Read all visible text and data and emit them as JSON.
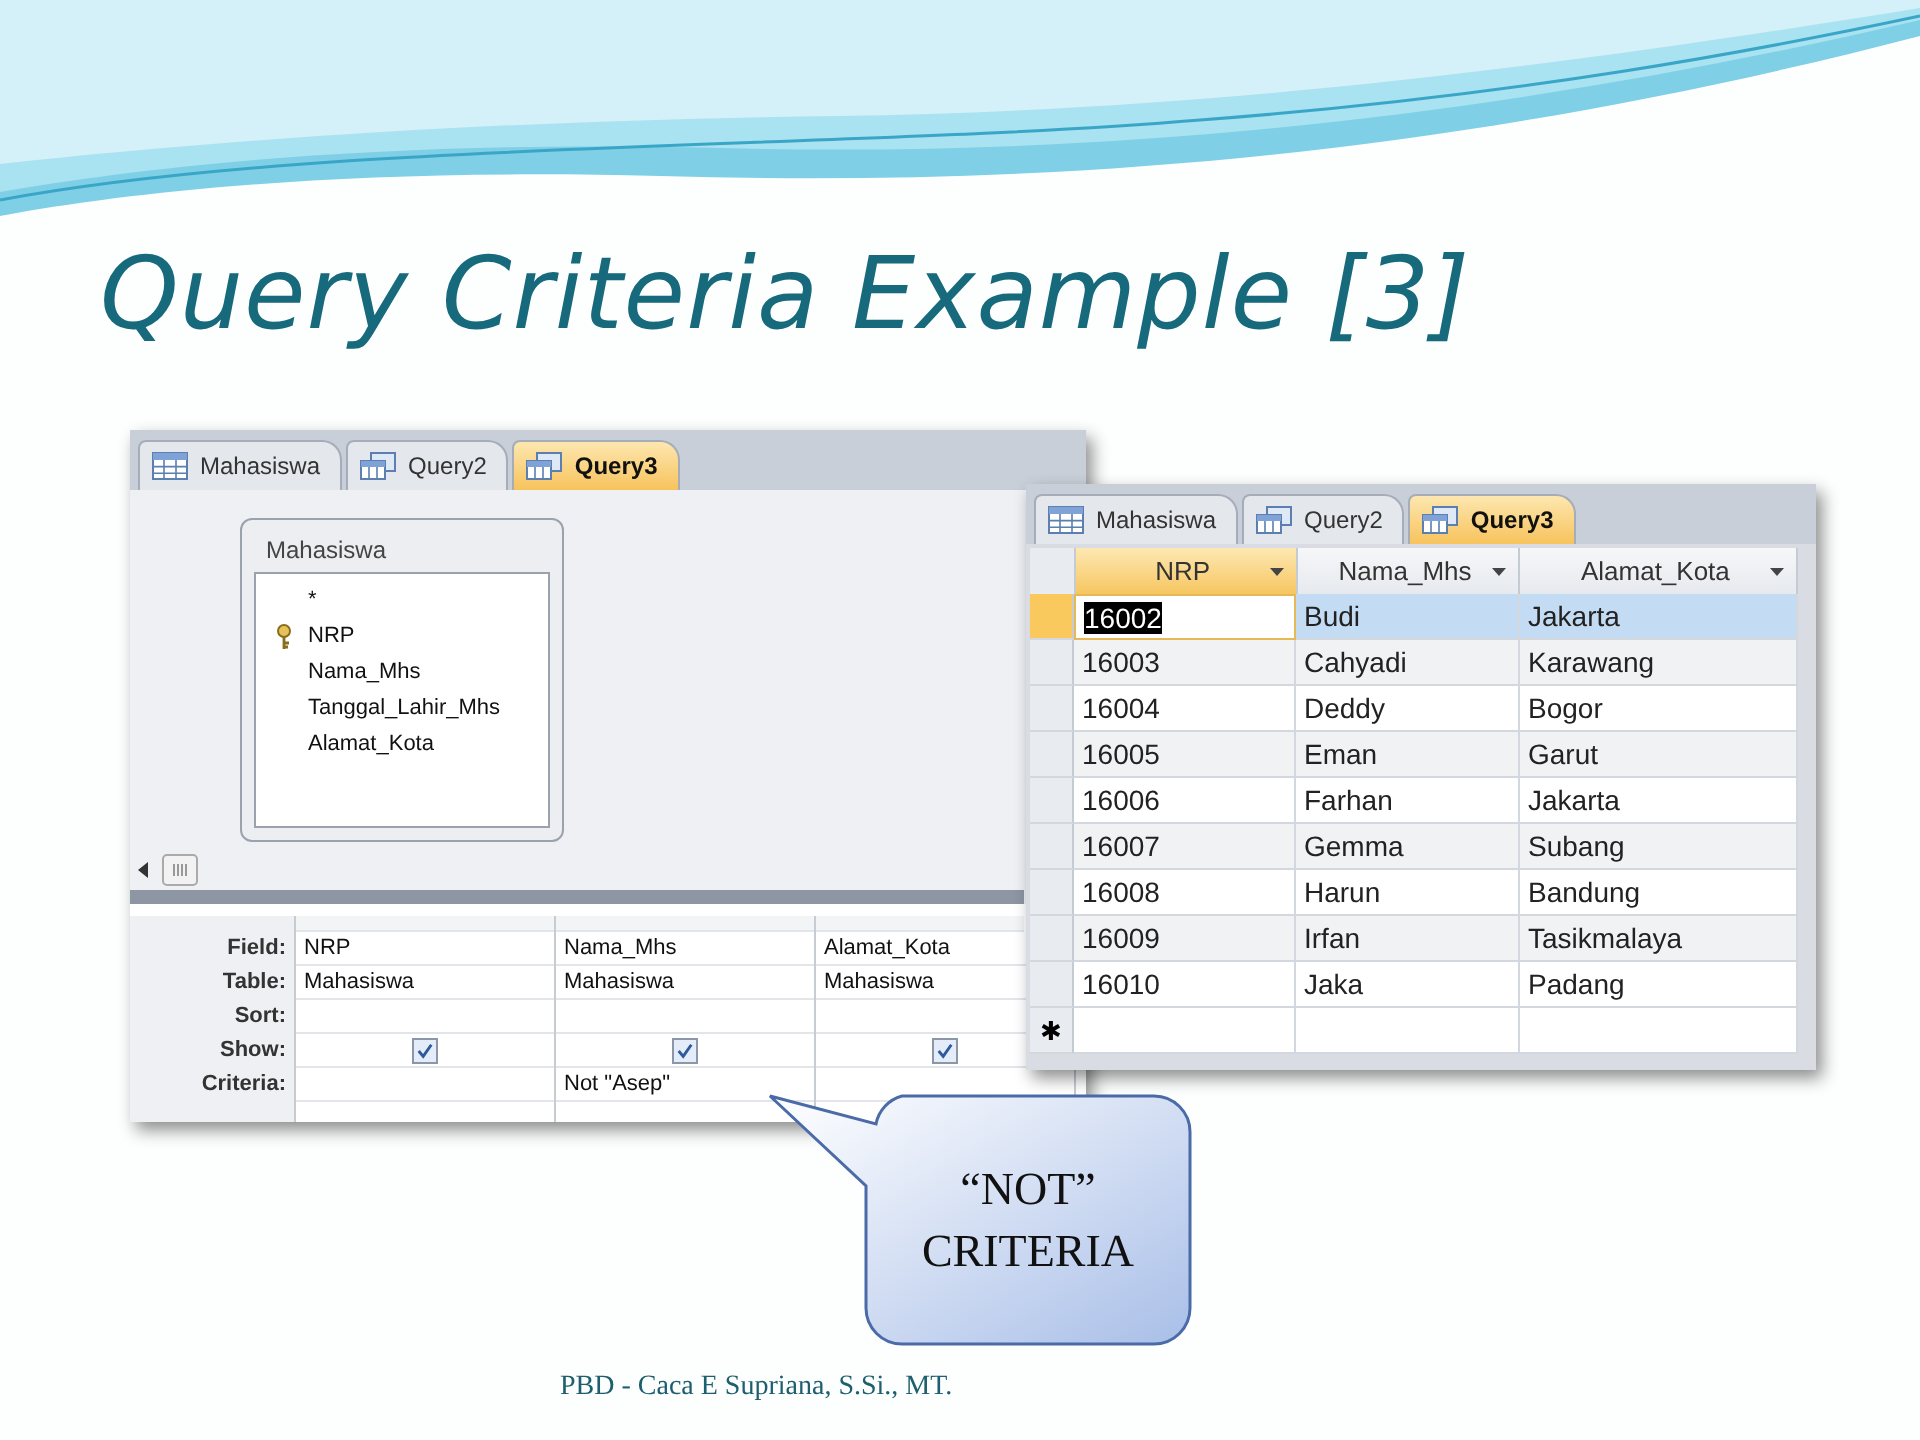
{
  "slide": {
    "title": "Query Criteria Example [3]",
    "footer": "PBD - Caca E Supriana, S.Si., MT."
  },
  "design_window": {
    "tabs": [
      {
        "label": "Mahasiswa",
        "kind": "table",
        "selected": false
      },
      {
        "label": "Query2",
        "kind": "query",
        "selected": false
      },
      {
        "label": "Query3",
        "kind": "query",
        "selected": true
      }
    ],
    "table_box": {
      "title": "Mahasiswa",
      "fields": [
        {
          "name": "*",
          "primary_key": false
        },
        {
          "name": "NRP",
          "primary_key": true
        },
        {
          "name": "Nama_Mhs",
          "primary_key": false
        },
        {
          "name": "Tanggal_Lahir_Mhs",
          "primary_key": false
        },
        {
          "name": "Alamat_Kota",
          "primary_key": false
        }
      ]
    },
    "grid": {
      "row_labels": [
        "Field:",
        "Table:",
        "Sort:",
        "Show:",
        "Criteria:"
      ],
      "columns": [
        {
          "field": "NRP",
          "table": "Mahasiswa",
          "show": true
        },
        {
          "field": "Nama_Mhs",
          "table": "Mahasiswa",
          "show": true,
          "criteria": "Not \"Asep\""
        },
        {
          "field": "Alamat_Kota",
          "table": "Mahasiswa",
          "show": true
        }
      ]
    }
  },
  "datasheet_window": {
    "tabs": [
      {
        "label": "Mahasiswa",
        "kind": "table",
        "selected": false
      },
      {
        "label": "Query2",
        "kind": "query",
        "selected": false
      },
      {
        "label": "Query3",
        "kind": "query",
        "selected": true
      }
    ],
    "columns": [
      {
        "label": "NRP",
        "selected": true
      },
      {
        "label": "Nama_Mhs",
        "selected": false
      },
      {
        "label": "Alamat_Kota",
        "selected": false
      }
    ],
    "rows": [
      {
        "cells": [
          "16002",
          "Budi",
          "Jakarta"
        ],
        "selected": true
      },
      {
        "cells": [
          "16003",
          "Cahyadi",
          "Karawang"
        ],
        "selected": false
      },
      {
        "cells": [
          "16004",
          "Deddy",
          "Bogor"
        ],
        "selected": false
      },
      {
        "cells": [
          "16005",
          "Eman",
          "Garut"
        ],
        "selected": false
      },
      {
        "cells": [
          "16006",
          "Farhan",
          "Jakarta"
        ],
        "selected": false
      },
      {
        "cells": [
          "16007",
          "Gemma",
          "Subang"
        ],
        "selected": false
      },
      {
        "cells": [
          "16008",
          "Harun",
          "Bandung"
        ],
        "selected": false
      },
      {
        "cells": [
          "16009",
          "Irfan",
          "Tasikmalaya"
        ],
        "selected": false
      },
      {
        "cells": [
          "16010",
          "Jaka",
          "Padang"
        ],
        "selected": false
      }
    ],
    "new_row_marker": "✱"
  },
  "callout": {
    "lines": [
      "“NOT”",
      "CRITERIA"
    ]
  }
}
